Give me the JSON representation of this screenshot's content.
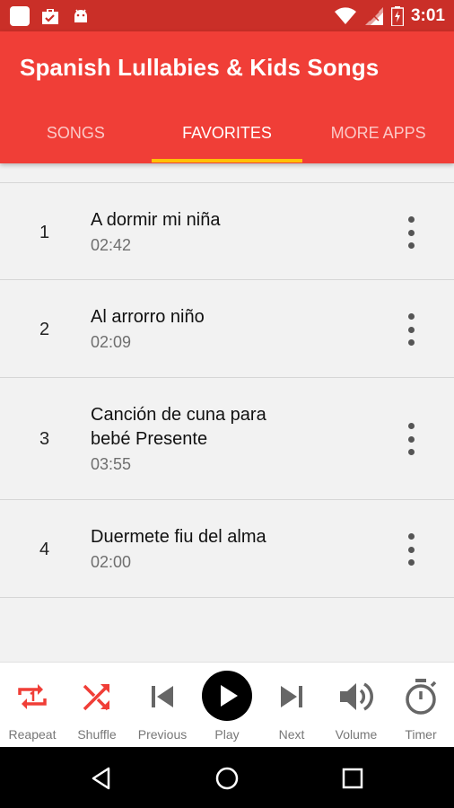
{
  "status_bar": {
    "time": "3:01",
    "icons": [
      "app-square-icon",
      "briefcase-check-icon",
      "android-icon",
      "wifi-icon",
      "signal-icon",
      "battery-charging-icon"
    ]
  },
  "app_bar": {
    "title": "Spanish Lullabies & Kids Songs",
    "tabs": [
      {
        "label": "SONGS",
        "active": false
      },
      {
        "label": "FAVORITES",
        "active": true
      },
      {
        "label": "MORE APPS",
        "active": false
      }
    ],
    "colors": {
      "primary": "#f03e37",
      "status": "#ca2f28",
      "indicator": "#ffc107"
    }
  },
  "songs": [
    {
      "number": "1",
      "title": "A dormir mi niña",
      "duration": "02:42"
    },
    {
      "number": "2",
      "title": "Al arrorro niño",
      "duration": "02:09"
    },
    {
      "number": "3",
      "title": "Canción de cuna para bebé Presente",
      "duration": "03:55"
    },
    {
      "number": "4",
      "title": "Duermete fiu del alma",
      "duration": "02:00"
    }
  ],
  "controls": {
    "repeat": {
      "label": "Reapeat",
      "icon": "repeat-one-icon"
    },
    "shuffle": {
      "label": "Shuffle",
      "icon": "shuffle-icon"
    },
    "previous": {
      "label": "Previous",
      "icon": "skip-previous-icon"
    },
    "play": {
      "label": "Play",
      "icon": "play-icon"
    },
    "next": {
      "label": "Next",
      "icon": "skip-next-icon"
    },
    "volume": {
      "label": "Volume",
      "icon": "volume-icon"
    },
    "timer": {
      "label": "Timer",
      "icon": "timer-icon"
    },
    "accent_color": "#f03e37"
  },
  "nav_bar": {
    "buttons": [
      "back-icon",
      "home-icon",
      "recents-icon"
    ]
  }
}
